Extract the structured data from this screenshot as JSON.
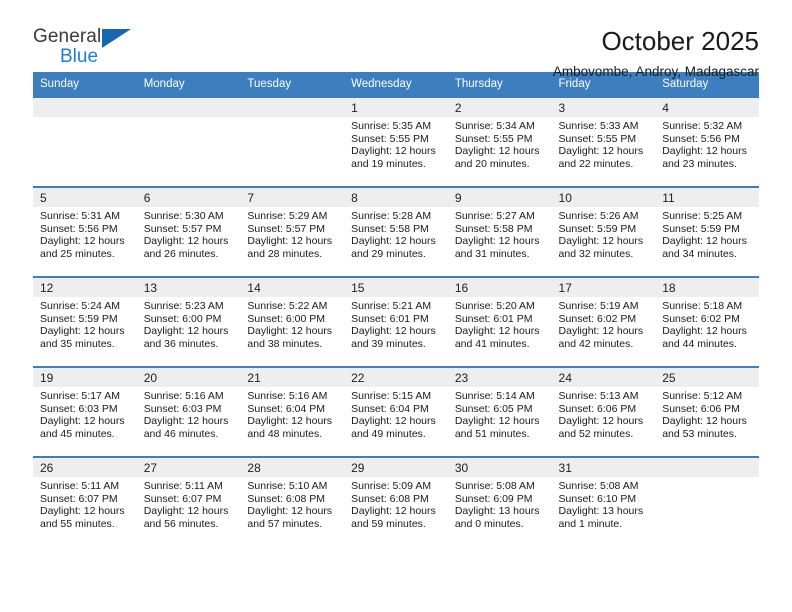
{
  "brand": {
    "name_top": "General",
    "name_bottom": "Blue",
    "accent_color": "#1b7fd4",
    "triangle_color": "#1567b0"
  },
  "header": {
    "title": "October 2025",
    "subtitle": "Ambovombe, Androy, Madagascar"
  },
  "theme": {
    "header_row_bg": "#3d7ebf",
    "daynum_bg": "#eeeeee",
    "row_border": "#3d7ebf"
  },
  "weekday_headers": [
    "Sunday",
    "Monday",
    "Tuesday",
    "Wednesday",
    "Thursday",
    "Friday",
    "Saturday"
  ],
  "weeks": [
    [
      {
        "day": "",
        "empty": true
      },
      {
        "day": "",
        "empty": true
      },
      {
        "day": "",
        "empty": true
      },
      {
        "day": "1",
        "sunrise": "Sunrise: 5:35 AM",
        "sunset": "Sunset: 5:55 PM",
        "daylight": "Daylight: 12 hours and 19 minutes."
      },
      {
        "day": "2",
        "sunrise": "Sunrise: 5:34 AM",
        "sunset": "Sunset: 5:55 PM",
        "daylight": "Daylight: 12 hours and 20 minutes."
      },
      {
        "day": "3",
        "sunrise": "Sunrise: 5:33 AM",
        "sunset": "Sunset: 5:55 PM",
        "daylight": "Daylight: 12 hours and 22 minutes."
      },
      {
        "day": "4",
        "sunrise": "Sunrise: 5:32 AM",
        "sunset": "Sunset: 5:56 PM",
        "daylight": "Daylight: 12 hours and 23 minutes."
      }
    ],
    [
      {
        "day": "5",
        "sunrise": "Sunrise: 5:31 AM",
        "sunset": "Sunset: 5:56 PM",
        "daylight": "Daylight: 12 hours and 25 minutes."
      },
      {
        "day": "6",
        "sunrise": "Sunrise: 5:30 AM",
        "sunset": "Sunset: 5:57 PM",
        "daylight": "Daylight: 12 hours and 26 minutes."
      },
      {
        "day": "7",
        "sunrise": "Sunrise: 5:29 AM",
        "sunset": "Sunset: 5:57 PM",
        "daylight": "Daylight: 12 hours and 28 minutes."
      },
      {
        "day": "8",
        "sunrise": "Sunrise: 5:28 AM",
        "sunset": "Sunset: 5:58 PM",
        "daylight": "Daylight: 12 hours and 29 minutes."
      },
      {
        "day": "9",
        "sunrise": "Sunrise: 5:27 AM",
        "sunset": "Sunset: 5:58 PM",
        "daylight": "Daylight: 12 hours and 31 minutes."
      },
      {
        "day": "10",
        "sunrise": "Sunrise: 5:26 AM",
        "sunset": "Sunset: 5:59 PM",
        "daylight": "Daylight: 12 hours and 32 minutes."
      },
      {
        "day": "11",
        "sunrise": "Sunrise: 5:25 AM",
        "sunset": "Sunset: 5:59 PM",
        "daylight": "Daylight: 12 hours and 34 minutes."
      }
    ],
    [
      {
        "day": "12",
        "sunrise": "Sunrise: 5:24 AM",
        "sunset": "Sunset: 5:59 PM",
        "daylight": "Daylight: 12 hours and 35 minutes."
      },
      {
        "day": "13",
        "sunrise": "Sunrise: 5:23 AM",
        "sunset": "Sunset: 6:00 PM",
        "daylight": "Daylight: 12 hours and 36 minutes."
      },
      {
        "day": "14",
        "sunrise": "Sunrise: 5:22 AM",
        "sunset": "Sunset: 6:00 PM",
        "daylight": "Daylight: 12 hours and 38 minutes."
      },
      {
        "day": "15",
        "sunrise": "Sunrise: 5:21 AM",
        "sunset": "Sunset: 6:01 PM",
        "daylight": "Daylight: 12 hours and 39 minutes."
      },
      {
        "day": "16",
        "sunrise": "Sunrise: 5:20 AM",
        "sunset": "Sunset: 6:01 PM",
        "daylight": "Daylight: 12 hours and 41 minutes."
      },
      {
        "day": "17",
        "sunrise": "Sunrise: 5:19 AM",
        "sunset": "Sunset: 6:02 PM",
        "daylight": "Daylight: 12 hours and 42 minutes."
      },
      {
        "day": "18",
        "sunrise": "Sunrise: 5:18 AM",
        "sunset": "Sunset: 6:02 PM",
        "daylight": "Daylight: 12 hours and 44 minutes."
      }
    ],
    [
      {
        "day": "19",
        "sunrise": "Sunrise: 5:17 AM",
        "sunset": "Sunset: 6:03 PM",
        "daylight": "Daylight: 12 hours and 45 minutes."
      },
      {
        "day": "20",
        "sunrise": "Sunrise: 5:16 AM",
        "sunset": "Sunset: 6:03 PM",
        "daylight": "Daylight: 12 hours and 46 minutes."
      },
      {
        "day": "21",
        "sunrise": "Sunrise: 5:16 AM",
        "sunset": "Sunset: 6:04 PM",
        "daylight": "Daylight: 12 hours and 48 minutes."
      },
      {
        "day": "22",
        "sunrise": "Sunrise: 5:15 AM",
        "sunset": "Sunset: 6:04 PM",
        "daylight": "Daylight: 12 hours and 49 minutes."
      },
      {
        "day": "23",
        "sunrise": "Sunrise: 5:14 AM",
        "sunset": "Sunset: 6:05 PM",
        "daylight": "Daylight: 12 hours and 51 minutes."
      },
      {
        "day": "24",
        "sunrise": "Sunrise: 5:13 AM",
        "sunset": "Sunset: 6:06 PM",
        "daylight": "Daylight: 12 hours and 52 minutes."
      },
      {
        "day": "25",
        "sunrise": "Sunrise: 5:12 AM",
        "sunset": "Sunset: 6:06 PM",
        "daylight": "Daylight: 12 hours and 53 minutes."
      }
    ],
    [
      {
        "day": "26",
        "sunrise": "Sunrise: 5:11 AM",
        "sunset": "Sunset: 6:07 PM",
        "daylight": "Daylight: 12 hours and 55 minutes."
      },
      {
        "day": "27",
        "sunrise": "Sunrise: 5:11 AM",
        "sunset": "Sunset: 6:07 PM",
        "daylight": "Daylight: 12 hours and 56 minutes."
      },
      {
        "day": "28",
        "sunrise": "Sunrise: 5:10 AM",
        "sunset": "Sunset: 6:08 PM",
        "daylight": "Daylight: 12 hours and 57 minutes."
      },
      {
        "day": "29",
        "sunrise": "Sunrise: 5:09 AM",
        "sunset": "Sunset: 6:08 PM",
        "daylight": "Daylight: 12 hours and 59 minutes."
      },
      {
        "day": "30",
        "sunrise": "Sunrise: 5:08 AM",
        "sunset": "Sunset: 6:09 PM",
        "daylight": "Daylight: 13 hours and 0 minutes."
      },
      {
        "day": "31",
        "sunrise": "Sunrise: 5:08 AM",
        "sunset": "Sunset: 6:10 PM",
        "daylight": "Daylight: 13 hours and 1 minute."
      },
      {
        "day": "",
        "empty": true
      }
    ]
  ]
}
